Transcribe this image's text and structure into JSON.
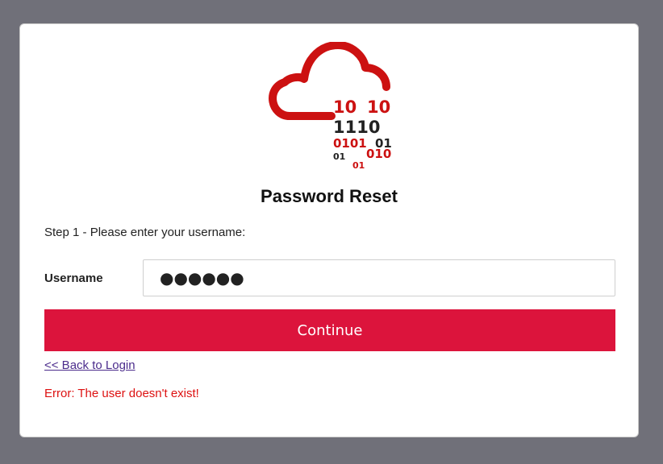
{
  "logo": {
    "icon": "cloud-binary-icon",
    "binary_rows": [
      "10",
      "10",
      "1110",
      "0101",
      "01",
      "01",
      "010",
      "01"
    ],
    "colors": {
      "cloud": "#cc1111",
      "dark": "#222222"
    }
  },
  "page": {
    "title": "Password Reset",
    "instructions": "Step 1 - Please enter your username:"
  },
  "form": {
    "username_label": "Username",
    "username_value": "●●●●●●",
    "continue_label": "Continue"
  },
  "links": {
    "back_label": "<< Back to Login"
  },
  "status": {
    "error": "Error: The user doesn't exist!"
  },
  "colors": {
    "background": "#707079",
    "accent": "#dc143c",
    "error": "#dd1111",
    "link": "#4b2c8c"
  }
}
